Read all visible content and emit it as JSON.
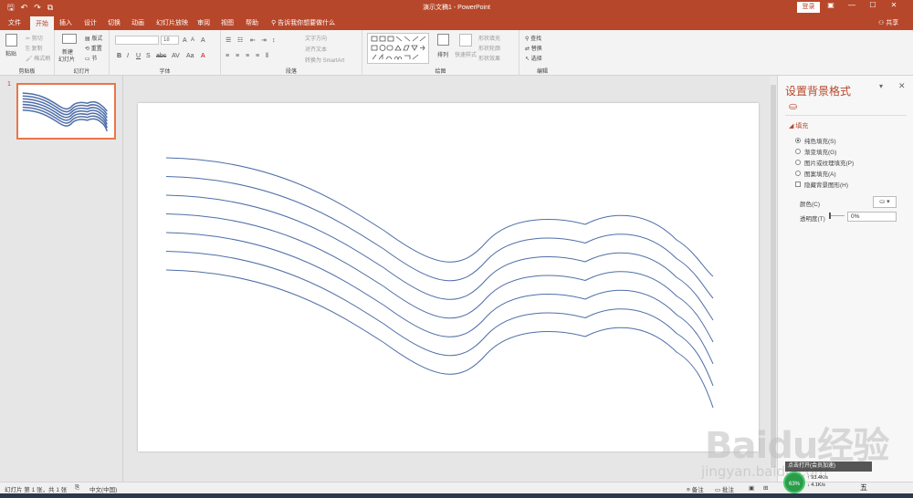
{
  "titlebar": {
    "doc_title": "演示文稿1 - PowerPoint",
    "login_label": "登录",
    "qat_icons": [
      "save-icon",
      "undo-icon",
      "redo-icon",
      "present-icon"
    ]
  },
  "tabs": {
    "items": [
      "文件",
      "开始",
      "插入",
      "设计",
      "切换",
      "动画",
      "幻灯片放映",
      "审阅",
      "视图",
      "帮助"
    ],
    "active": "开始",
    "tell_me": "告诉我你想要做什么",
    "share": "共享"
  },
  "ribbon": {
    "clipboard": {
      "label": "剪贴板",
      "paste": "粘贴",
      "cut": "剪切",
      "copy": "复制",
      "format_painter": "格式刷"
    },
    "slides": {
      "label": "幻灯片",
      "new_slide": "新建",
      "new_slide2": "幻灯片",
      "layout": "版式",
      "reset": "重置",
      "section": "节"
    },
    "font": {
      "label": "字体",
      "font_size": "18"
    },
    "paragraph": {
      "label": "段落",
      "text_direction": "文字方向",
      "align_text": "对齐文本",
      "smartart": "转换为 SmartArt"
    },
    "drawing": {
      "label": "绘图",
      "arrange": "排列",
      "quick_styles": "快速样式",
      "shape_fill": "形状填充",
      "shape_outline": "形状轮廓",
      "shape_effects": "形状效果"
    },
    "editing": {
      "label": "编辑",
      "find": "查找",
      "replace": "替换",
      "select": "选择"
    }
  },
  "thumbnails": {
    "slide_number": "1"
  },
  "format_pane": {
    "title": "设置背景格式",
    "section": "填充",
    "options": [
      "纯色填充(S)",
      "渐变填充(G)",
      "图片或纹理填充(P)",
      "图案填充(A)"
    ],
    "selected_option": "纯色填充(S)",
    "hide_background": "隐藏背景图形(H)",
    "color_label": "颜色(C)",
    "transparency_label": "透明度(T)",
    "transparency_value": "0%",
    "transparency_fraction": 0
  },
  "statusbar": {
    "slide_info": "幻灯片 第 1 张，共 1 张",
    "language": "中文(中国)",
    "notes": "备注",
    "comments": "批注"
  },
  "overlay": {
    "watermark": "Baidu经验",
    "watermark_url": "jingyan.baidu.com",
    "tooltip": "点击打开(会员加速)",
    "gauge": "63%",
    "net_up": "93.4K/s",
    "net_down": "4.1K/s",
    "ime": "五"
  },
  "colors": {
    "accent": "#b7472a",
    "wave_line": "#4f6ea8"
  }
}
